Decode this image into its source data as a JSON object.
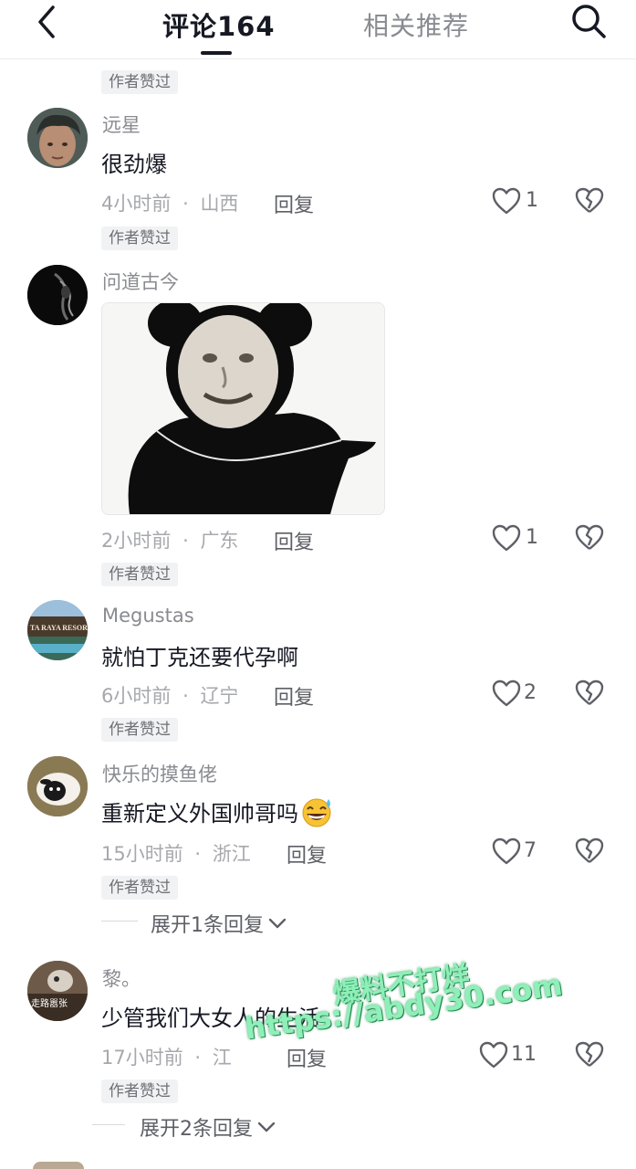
{
  "header": {
    "tab_comments": "评论164",
    "tab_recommend": "相关推荐"
  },
  "badge_author_liked": "作者赞过",
  "reply_label": "回复",
  "comments": [
    {
      "username": "远星",
      "text": "很劲爆",
      "time": "4小时前",
      "region": "山西",
      "likes": "1"
    },
    {
      "username": "问道古今",
      "text": "",
      "time": "2小时前",
      "region": "广东",
      "likes": "1"
    },
    {
      "username": "Megustas",
      "text": "就怕丁克还要代孕啊",
      "time": "6小时前",
      "region": "辽宁",
      "likes": "2"
    },
    {
      "username": "快乐的摸鱼佬",
      "text": "重新定义外国帅哥吗",
      "time": "15小时前",
      "region": "浙江",
      "likes": "7",
      "expand": "展开1条回复"
    },
    {
      "username": "黎。",
      "text": "少管我们大女人的生活",
      "time": "17小时前",
      "region": "江",
      "likes": "11",
      "expand": "展开2条回复"
    }
  ],
  "separator": "·",
  "avatar_texts": {
    "megustas_sign": "TA RAYA RESORT",
    "li_avatar": "走路嚣张"
  },
  "watermark": {
    "line1": "爆料不打烊",
    "line2": "https://abdy30.com"
  },
  "colors": {
    "text_primary": "#161823",
    "text_secondary": "#8a8b91",
    "badge_bg": "#f1f2f4",
    "watermark": "#8ef0b8"
  },
  "icons": [
    "back-arrow-icon",
    "search-icon",
    "heart-outline-icon",
    "broken-heart-icon",
    "chevron-down-icon",
    "laughing-sweat-emoji"
  ]
}
